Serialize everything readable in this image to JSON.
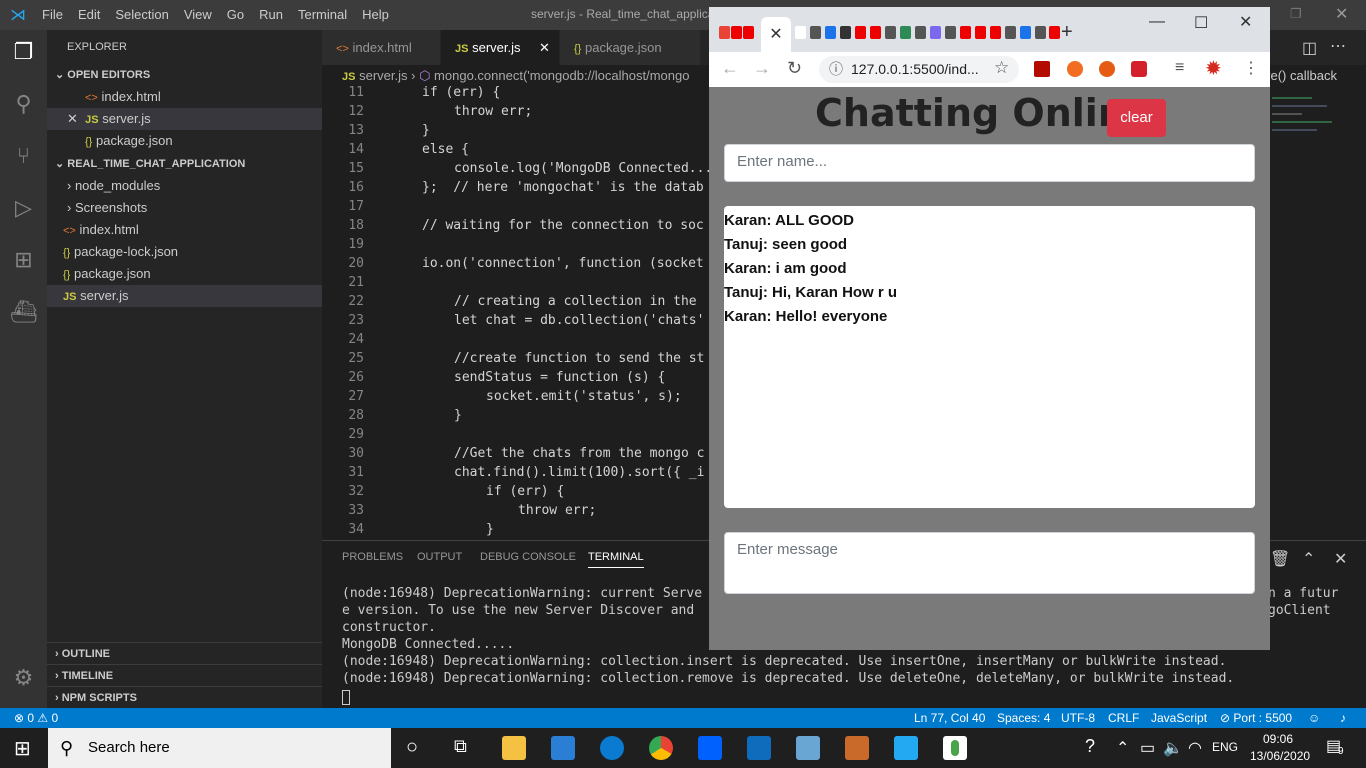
{
  "window": {
    "title": "server.js - Real_time_chat_applicat"
  },
  "menu": [
    "File",
    "Edit",
    "Selection",
    "View",
    "Go",
    "Run",
    "Terminal",
    "Help"
  ],
  "explorer": {
    "title": "EXPLORER",
    "open_editors_label": "OPEN EDITORS",
    "open_editors": [
      "index.html",
      "server.js",
      "package.json"
    ],
    "project_label": "REAL_TIME_CHAT_APPLICATION",
    "files": [
      "node_modules",
      "Screenshots",
      "index.html",
      "package-lock.json",
      "package.json",
      "server.js"
    ],
    "outline": "OUTLINE",
    "timeline": "TIMELINE",
    "npm": "NPM SCRIPTS",
    "file_icons": {
      "js": "JS",
      "html": "<>",
      "json": "{}"
    }
  },
  "tabs": [
    "index.html",
    "server.js",
    "package.json"
  ],
  "breadcrumb": {
    "file": "server.js",
    "symbol": "mongo.connect('mongodb://localhost/mongo"
  },
  "editor": {
    "right_text": "ve() callback",
    "lines": [
      {
        "n": "11",
        "t": "if (err) {"
      },
      {
        "n": "12",
        "t": "throw err;"
      },
      {
        "n": "13",
        "t": "}"
      },
      {
        "n": "14",
        "t": "else {"
      },
      {
        "n": "15",
        "t": "console.log('MongoDB Connected..."
      },
      {
        "n": "16",
        "t": "};  // here 'mongochat' is the datab"
      },
      {
        "n": "17",
        "t": ""
      },
      {
        "n": "18",
        "t": "// waiting for the connection to soc"
      },
      {
        "n": "19",
        "t": ""
      },
      {
        "n": "20",
        "t": "io.on('connection', function (socket"
      },
      {
        "n": "21",
        "t": ""
      },
      {
        "n": "22",
        "t": "// creating a collection in the"
      },
      {
        "n": "23",
        "t": "let chat = db.collection('chats'"
      },
      {
        "n": "24",
        "t": ""
      },
      {
        "n": "25",
        "t": "//create function to send the st"
      },
      {
        "n": "26",
        "t": "sendStatus = function (s) {"
      },
      {
        "n": "27",
        "t": "socket.emit('status', s);"
      },
      {
        "n": "28",
        "t": "}"
      },
      {
        "n": "29",
        "t": ""
      },
      {
        "n": "30",
        "t": "//Get the chats from the mongo c"
      },
      {
        "n": "31",
        "t": "chat.find().limit(100).sort({ _i"
      },
      {
        "n": "32",
        "t": "if (err) {"
      },
      {
        "n": "33",
        "t": "throw err;"
      },
      {
        "n": "34",
        "t": "}"
      }
    ]
  },
  "panel": {
    "tabs": [
      "PROBLEMS",
      "OUTPUT",
      "DEBUG CONSOLE",
      "TERMINAL"
    ],
    "lines": [
      "(node:16948) DeprecationWarning: current Serve",
      "e version. To use the new Server Discover and ",
      "constructor.",
      "MongoDB Connected.....",
      "(node:16948) DeprecationWarning: collection.insert is deprecated. Use insertOne, insertMany or bulkWrite instead.",
      "(node:16948) DeprecationWarning: collection.remove is deprecated. Use deleteOne, deleteMany, or bulkWrite instead."
    ],
    "right1": "n a futur",
    "right2": "goClient"
  },
  "status": {
    "problems": "⊗ 0 ⚠ 0",
    "ln": "Ln 77, Col 40",
    "spaces": "Spaces: 4",
    "enc": "UTF-8",
    "eol": "CRLF",
    "lang": "JavaScript",
    "port": "⊘ Port : 5500"
  },
  "browser": {
    "url": "127.0.0.1:5500/ind...",
    "page": {
      "title": "Chatting Online",
      "clear": "clear",
      "name_placeholder": "Enter name...",
      "message_placeholder": "Enter message",
      "messages": [
        "Karan: ALL GOOD",
        "Tanuj: seen good",
        "Karan: i am good",
        "Tanuj: Hi, Karan How r u",
        "Karan: Hello! everyone"
      ]
    }
  },
  "taskbar": {
    "search": "Search here",
    "time": "09:06",
    "date": "13/06/2020",
    "lang": "ENG",
    "notif": "9"
  }
}
